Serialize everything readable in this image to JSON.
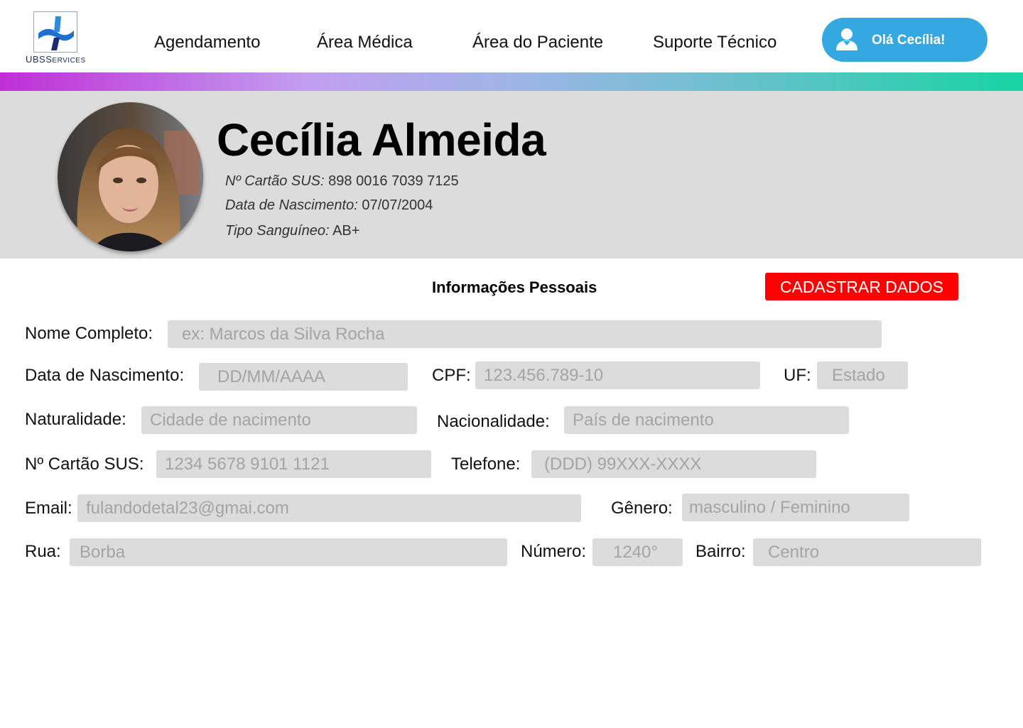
{
  "header": {
    "logo_text": "UBS",
    "logo_text_small": "ERVICES",
    "logo_text_cap": "S",
    "nav": [
      {
        "label": "Agendamento"
      },
      {
        "label": "Área Médica"
      },
      {
        "label": "Área do Paciente"
      },
      {
        "label": "Suporte Técnico"
      }
    ],
    "greeting": "Olá Cecília!"
  },
  "profile": {
    "name": "Cecília Almeida",
    "sus_label": "Nº Cartão SUS:",
    "sus_value": "898 0016 7039 7125",
    "birth_label": "Data de Nascimento:",
    "birth_value": "07/07/2004",
    "blood_label": "Tipo Sanguíneo:",
    "blood_value": "AB+"
  },
  "form": {
    "title": "Informações Pessoais",
    "register_button": "CADASTRAR DADOS",
    "fields": {
      "nome": {
        "label": "Nome Completo:",
        "placeholder": "ex: Marcos da Silva Rocha"
      },
      "nascimento": {
        "label": "Data de Nascimento:",
        "placeholder": "DD/MM/AAAA"
      },
      "cpf": {
        "label": "CPF:",
        "placeholder": "123.456.789-10"
      },
      "uf": {
        "label": "UF:",
        "placeholder": "Estado"
      },
      "naturalidade": {
        "label": "Naturalidade:",
        "placeholder": "Cidade de nacimento"
      },
      "nacionalidade": {
        "label": "Nacionalidade:",
        "placeholder": "País de nacimento"
      },
      "sus": {
        "label": "Nº Cartão SUS:",
        "placeholder": "1234 5678 9101 1121"
      },
      "telefone": {
        "label": "Telefone:",
        "placeholder": "(DDD) 99XXX-XXXX"
      },
      "email": {
        "label": "Email:",
        "placeholder": "fulandodetal23@gmai.com"
      },
      "genero": {
        "label": "Gênero:",
        "placeholder": "masculino / Feminino"
      },
      "rua": {
        "label": "Rua:",
        "placeholder": "Borba"
      },
      "numero": {
        "label": "Número:",
        "placeholder": "1240°"
      },
      "bairro": {
        "label": "Bairro:",
        "placeholder": "Centro"
      }
    }
  },
  "colors": {
    "accent_blue": "#35a8e0",
    "register_red": "#ff0000",
    "banner_gray": "#dcdcdc",
    "logo_navy": "#1e2f6b"
  },
  "icons": {
    "logo": "medical-cross-logo",
    "user": "user-icon"
  }
}
